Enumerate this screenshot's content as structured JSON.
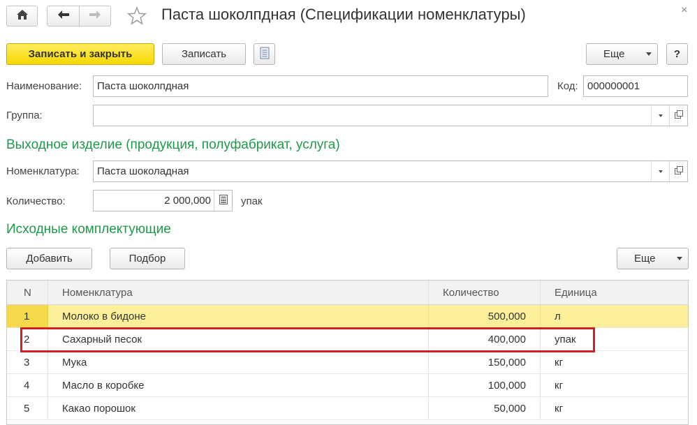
{
  "window": {
    "title": "Паста шоколпдная (Спецификации номенклатуры)",
    "close_glyph": "×"
  },
  "icons": {
    "home": "home-icon",
    "back": "arrow-left-icon",
    "forward": "arrow-right-icon",
    "favorite": "star-icon",
    "report": "document-icon",
    "calculator": "calculator-icon",
    "open": "open-window-icon"
  },
  "toolbar": {
    "save_close_label": "Записать и закрыть",
    "save_label": "Записать",
    "more_label": "Еще",
    "help_label": "?"
  },
  "form": {
    "name_label": "Наименование:",
    "name_value": "Паста шоколпдная",
    "code_label": "Код:",
    "code_value": "000000001",
    "group_label": "Группа:",
    "group_value": ""
  },
  "output": {
    "section_title": "Выходное изделие (продукция, полуфабрикат, услуга)",
    "nomenclature_label": "Номенклатура:",
    "nomenclature_value": "Паста шоколадная",
    "quantity_label": "Количество:",
    "quantity_value": "2 000,000",
    "unit": "упак"
  },
  "components": {
    "section_title": "Исходные комплектующие",
    "add_label": "Добавить",
    "pick_label": "Подбор",
    "more_label": "Еще",
    "columns": [
      "N",
      "Номенклатура",
      "Количество",
      "Единица"
    ],
    "rows": [
      {
        "n": "1",
        "name": "Молоко в бидоне",
        "qty": "500,000",
        "unit": "л"
      },
      {
        "n": "2",
        "name": "Сахарный песок",
        "qty": "400,000",
        "unit": "упак"
      },
      {
        "n": "3",
        "name": "Мука",
        "qty": "150,000",
        "unit": "кг"
      },
      {
        "n": "4",
        "name": "Масло в коробке",
        "qty": "100,000",
        "unit": "кг"
      },
      {
        "n": "5",
        "name": "Какао порошок",
        "qty": "50,000",
        "unit": "кг"
      }
    ]
  },
  "colors": {
    "accent_green": "#1e9a4a",
    "primary_button": "#f7d800",
    "selected_row": "#fbef9a",
    "highlight_border": "#cc2222"
  }
}
